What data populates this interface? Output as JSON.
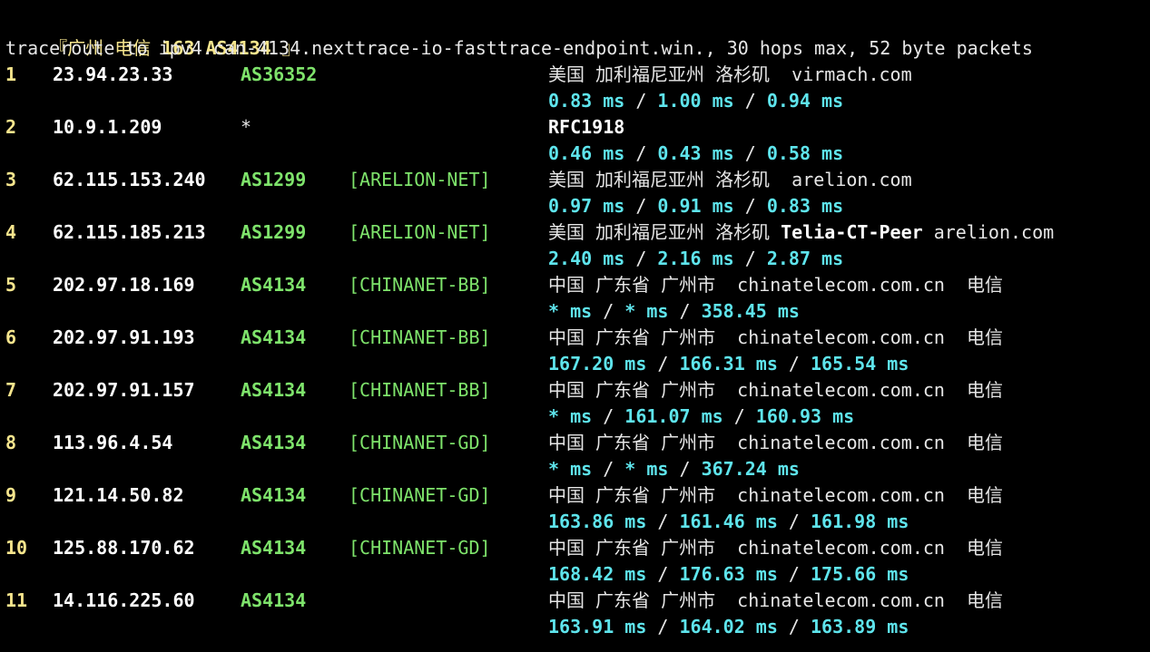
{
  "header": {
    "prefix": "『广州 电信 ",
    "strong": "163 AS4134",
    "suffix": " 』"
  },
  "trace_line": "traceroute to ipv4.can-4134.nexttrace-io-fasttrace-endpoint.win., 30 hops max, 52 byte packets",
  "hops": [
    {
      "hop": "1",
      "ip": "23.94.23.33",
      "asn": "AS36352",
      "tag": "",
      "geo": "美国 加利福尼亚州 洛杉矶  virmach.com",
      "geo_bold": "",
      "rtt": [
        "0.83 ms",
        "1.00 ms",
        "0.94 ms"
      ]
    },
    {
      "hop": "2",
      "ip": "10.9.1.209",
      "asn": "*",
      "tag": "",
      "geo": "",
      "geo_bold": "RFC1918",
      "rtt": [
        "0.46 ms",
        "0.43 ms",
        "0.58 ms"
      ]
    },
    {
      "hop": "3",
      "ip": "62.115.153.240",
      "asn": "AS1299",
      "tag": "[ARELION-NET]",
      "geo": "美国 加利福尼亚州 洛杉矶  arelion.com",
      "geo_bold": "",
      "rtt": [
        "0.97 ms",
        "0.91 ms",
        "0.83 ms"
      ]
    },
    {
      "hop": "4",
      "ip": "62.115.185.213",
      "asn": "AS1299",
      "tag": "[ARELION-NET]",
      "geo": "美国 加利福尼亚州 洛杉矶 ",
      "geo_bold": "Telia-CT-Peer",
      "geo_tail": " arelion.com",
      "rtt": [
        "2.40 ms",
        "2.16 ms",
        "2.87 ms"
      ]
    },
    {
      "hop": "5",
      "ip": "202.97.18.169",
      "asn": "AS4134",
      "tag": "[CHINANET-BB]",
      "geo": "中国 广东省 广州市  chinatelecom.com.cn  电信",
      "geo_bold": "",
      "rtt": [
        "* ms",
        "* ms",
        "358.45 ms"
      ]
    },
    {
      "hop": "6",
      "ip": "202.97.91.193",
      "asn": "AS4134",
      "tag": "[CHINANET-BB]",
      "geo": "中国 广东省 广州市  chinatelecom.com.cn  电信",
      "geo_bold": "",
      "rtt": [
        "167.20 ms",
        "166.31 ms",
        "165.54 ms"
      ]
    },
    {
      "hop": "7",
      "ip": "202.97.91.157",
      "asn": "AS4134",
      "tag": "[CHINANET-BB]",
      "geo": "中国 广东省 广州市  chinatelecom.com.cn  电信",
      "geo_bold": "",
      "rtt": [
        "* ms",
        "161.07 ms",
        "160.93 ms"
      ]
    },
    {
      "hop": "8",
      "ip": "113.96.4.54",
      "asn": "AS4134",
      "tag": "[CHINANET-GD]",
      "geo": "中国 广东省 广州市  chinatelecom.com.cn  电信",
      "geo_bold": "",
      "rtt": [
        "* ms",
        "* ms",
        "367.24 ms"
      ]
    },
    {
      "hop": "9",
      "ip": "121.14.50.82",
      "asn": "AS4134",
      "tag": "[CHINANET-GD]",
      "geo": "中国 广东省 广州市  chinatelecom.com.cn  电信",
      "geo_bold": "",
      "rtt": [
        "163.86 ms",
        "161.46 ms",
        "161.98 ms"
      ]
    },
    {
      "hop": "10",
      "ip": "125.88.170.62",
      "asn": "AS4134",
      "tag": "[CHINANET-GD]",
      "geo": "中国 广东省 广州市  chinatelecom.com.cn  电信",
      "geo_bold": "",
      "rtt": [
        "168.42 ms",
        "176.63 ms",
        "175.66 ms"
      ]
    },
    {
      "hop": "11",
      "ip": "14.116.225.60",
      "asn": "AS4134",
      "tag": "",
      "geo": "中国 广东省 广州市  chinatelecom.com.cn  电信",
      "geo_bold": "",
      "rtt": [
        "163.91 ms",
        "164.02 ms",
        "163.89 ms"
      ]
    }
  ],
  "rtt_separator": " / ",
  "colors": {
    "background": "#000000",
    "hop_number": "#f6e58d",
    "ip": "#ffffff",
    "asn": "#7ee36b",
    "rtt": "#5ee4ec",
    "text": "#e6e6e6"
  }
}
